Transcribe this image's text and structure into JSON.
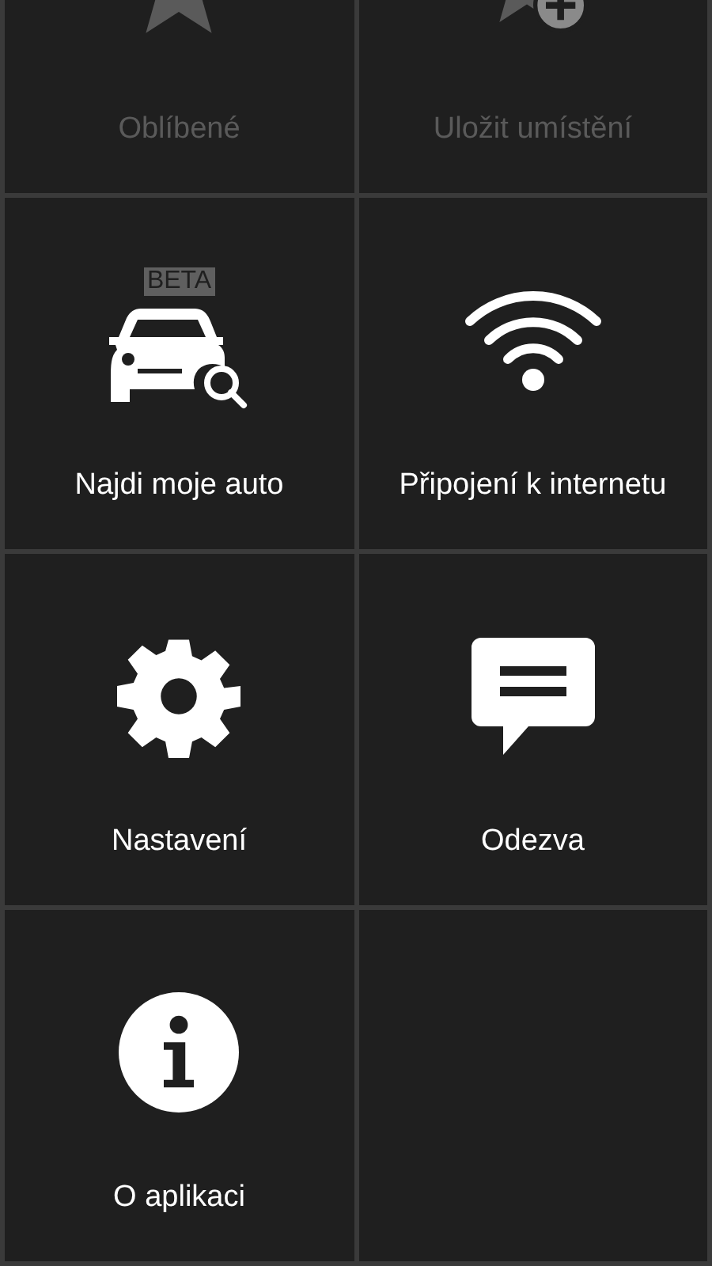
{
  "tiles": [
    {
      "label": "Oblíbené",
      "kind": "star",
      "disabled": true
    },
    {
      "label": "Uložit umístění",
      "kind": "star-add",
      "disabled": true
    },
    {
      "label": "Najdi moje auto",
      "kind": "car-search",
      "disabled": false,
      "badge": "BETA"
    },
    {
      "label": "Připojení k internetu",
      "kind": "wifi",
      "disabled": false
    },
    {
      "label": "Nastavení",
      "kind": "gear",
      "disabled": false
    },
    {
      "label": "Odezva",
      "kind": "chat",
      "disabled": false
    },
    {
      "label": "O aplikaci",
      "kind": "info",
      "disabled": false
    }
  ]
}
